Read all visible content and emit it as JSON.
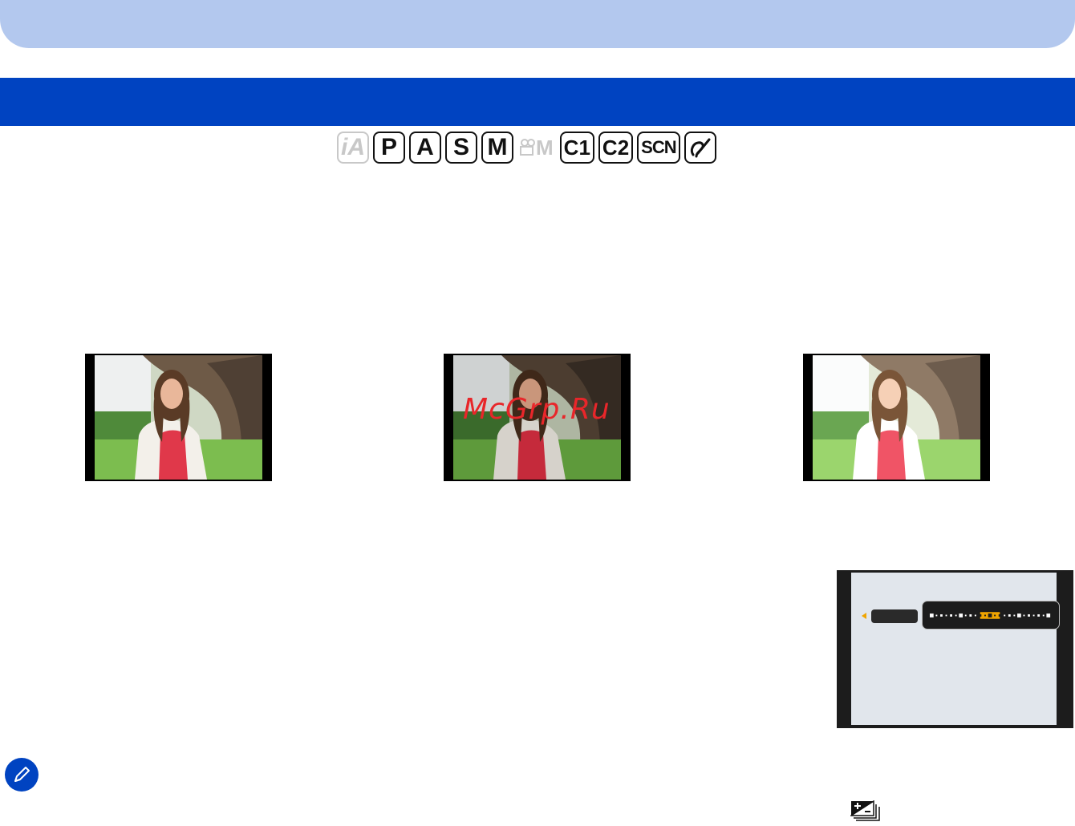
{
  "header": {
    "tab_color": "#b3c8ee",
    "bar_color": "#0043c1"
  },
  "modes": [
    {
      "label": "iA",
      "icon": "intelligent-auto-icon",
      "enabled": false
    },
    {
      "label": "P",
      "icon": "program-ae-icon",
      "enabled": true
    },
    {
      "label": "A",
      "icon": "aperture-priority-icon",
      "enabled": true
    },
    {
      "label": "S",
      "icon": "shutter-priority-icon",
      "enabled": true
    },
    {
      "label": "M",
      "icon": "manual-exposure-icon",
      "enabled": true
    },
    {
      "label": "M",
      "icon": "creative-video-icon",
      "enabled": false
    },
    {
      "label": "C1",
      "icon": "custom-1-icon",
      "enabled": true
    },
    {
      "label": "C2",
      "icon": "custom-2-icon",
      "enabled": true
    },
    {
      "label": "SCN",
      "icon": "scene-guide-icon",
      "enabled": true
    },
    {
      "label": "",
      "icon": "creative-control-icon",
      "enabled": true
    }
  ],
  "photos": [
    {
      "icon": "sample-photo-woman",
      "exposure": "normal"
    },
    {
      "icon": "sample-photo-woman",
      "exposure": "darker"
    },
    {
      "icon": "sample-photo-woman",
      "exposure": "brighter"
    }
  ],
  "watermark": "McGrp.Ru",
  "camera_screen": {
    "scale_ticks": 13,
    "selected_index": 6,
    "accent": "#f0a500"
  },
  "icons": {
    "note": "note-pencil-icon",
    "exposure_bracket": "auto-bracket-icon"
  }
}
